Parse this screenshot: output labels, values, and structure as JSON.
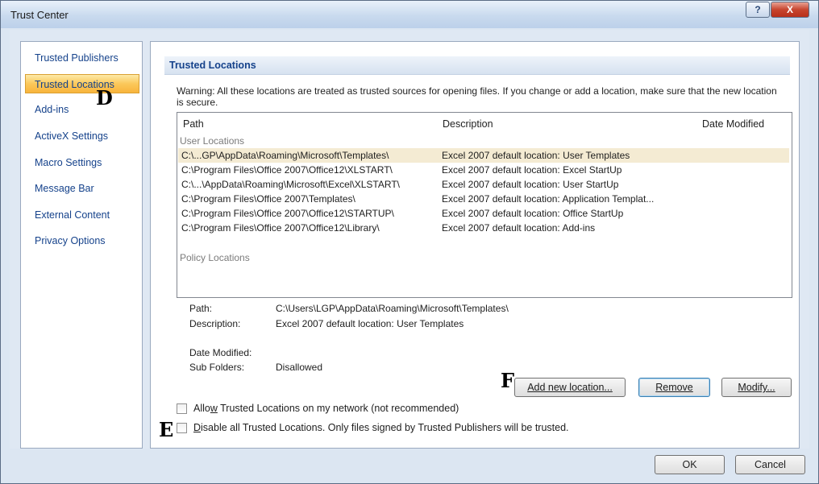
{
  "window": {
    "title": "Trust Center",
    "help_glyph": "?",
    "close_glyph": "X"
  },
  "sidebar": {
    "items": [
      {
        "label": "Trusted Publishers"
      },
      {
        "label": "Trusted Locations"
      },
      {
        "label": "Add-ins"
      },
      {
        "label": "ActiveX Settings"
      },
      {
        "label": "Macro Settings"
      },
      {
        "label": "Message Bar"
      },
      {
        "label": "External Content"
      },
      {
        "label": "Privacy Options"
      }
    ],
    "active_index": 1
  },
  "content": {
    "section_title": "Trusted Locations",
    "warning": "Warning: All these locations are treated as trusted sources for opening files.  If you change or add a location, make sure that the new location is secure.",
    "columns": {
      "path": "Path",
      "description": "Description",
      "date_modified": "Date Modified"
    },
    "user_group_label": "User Locations",
    "policy_group_label": "Policy Locations",
    "rows": [
      {
        "path": "C:\\...GP\\AppData\\Roaming\\Microsoft\\Templates\\",
        "description": "Excel 2007 default location: User Templates",
        "selected": true
      },
      {
        "path": "C:\\Program Files\\Office 2007\\Office12\\XLSTART\\",
        "description": "Excel 2007 default location: Excel StartUp"
      },
      {
        "path": "C:\\...\\AppData\\Roaming\\Microsoft\\Excel\\XLSTART\\",
        "description": "Excel 2007 default location: User StartUp"
      },
      {
        "path": "C:\\Program Files\\Office 2007\\Templates\\",
        "description": "Excel 2007 default location: Application Templat..."
      },
      {
        "path": "C:\\Program Files\\Office 2007\\Office12\\STARTUP\\",
        "description": "Excel 2007 default location: Office StartUp"
      },
      {
        "path": "C:\\Program Files\\Office 2007\\Office12\\Library\\",
        "description": "Excel 2007 default location: Add-ins"
      }
    ],
    "details": {
      "path_label": "Path:",
      "path_value": "C:\\Users\\LGP\\AppData\\Roaming\\Microsoft\\Templates\\",
      "description_label": "Description:",
      "description_value": "Excel 2007 default location: User Templates",
      "date_modified_label": "Date Modified:",
      "subfolders_label": "Sub Folders:",
      "subfolders_value": "Disallowed"
    },
    "buttons": {
      "add_new_location": "Add new location...",
      "remove": "Remove",
      "modify": "Modify..."
    },
    "checkboxes": {
      "allow_network_pre": "Allo",
      "allow_network_key": "w",
      "allow_network_post": " Trusted Locations on my network (not recommended)",
      "disable_all_key": "D",
      "disable_all_post": "isable all Trusted Locations. Only files signed by Trusted Publishers will be trusted."
    }
  },
  "footer": {
    "ok": "OK",
    "cancel": "Cancel"
  },
  "markers": {
    "d": "D",
    "e": "E",
    "f": "F"
  }
}
